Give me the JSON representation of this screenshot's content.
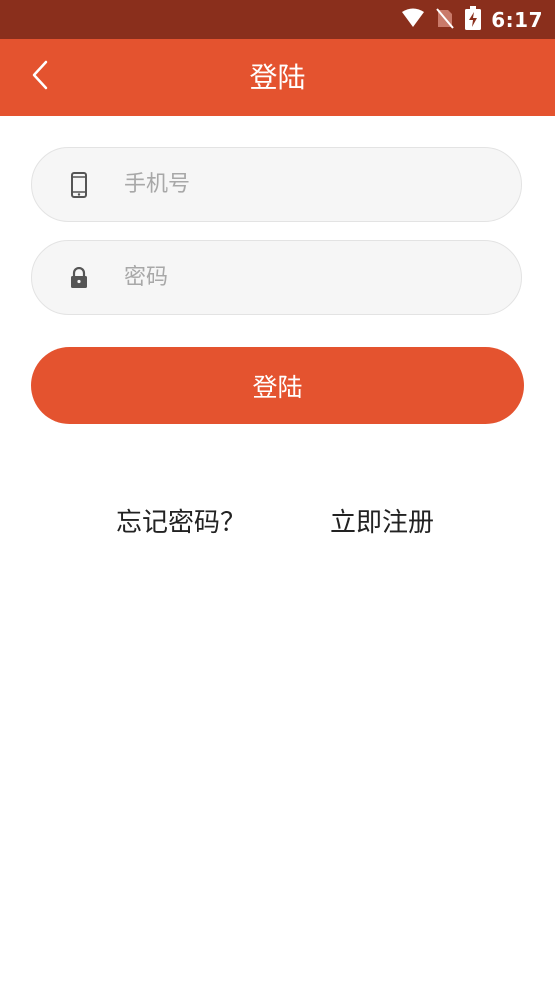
{
  "status_bar": {
    "time": "6:17",
    "icons": [
      "wifi-icon",
      "no-sim-icon",
      "battery-charging-icon"
    ]
  },
  "header": {
    "title": "登陆",
    "back_icon": "chevron-left-icon"
  },
  "form": {
    "phone": {
      "icon": "phone-icon",
      "placeholder": "手机号",
      "value": ""
    },
    "password": {
      "icon": "lock-icon",
      "placeholder": "密码",
      "value": ""
    },
    "submit_label": "登陆"
  },
  "links": {
    "forgot_password": "忘记密码？",
    "register": "立即注册"
  },
  "colors": {
    "status_bar": "#8a2f1c",
    "accent": "#e4532f",
    "field_background": "#f6f6f6",
    "field_border": "#e3e3e3"
  }
}
